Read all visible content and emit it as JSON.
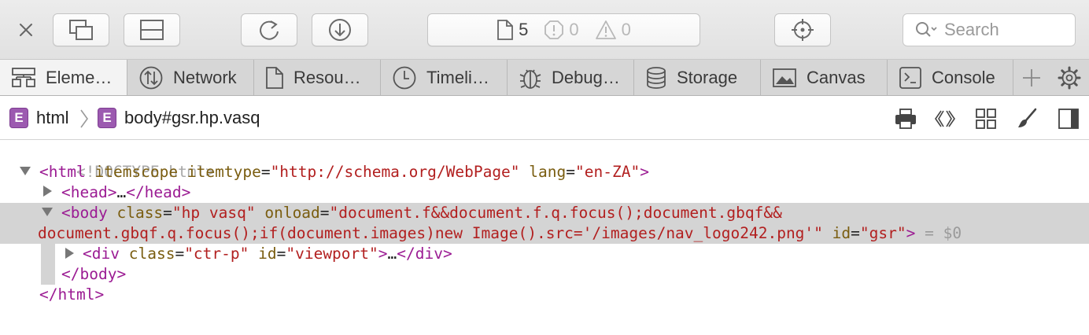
{
  "toolbar": {
    "counts": {
      "resources": "5",
      "errors": "0",
      "warnings": "0"
    },
    "search_placeholder": "Search"
  },
  "tabs": [
    {
      "label": "Eleme…",
      "icon": "elements-icon",
      "active": true
    },
    {
      "label": "Network",
      "icon": "network-icon"
    },
    {
      "label": "Resou…",
      "icon": "resources-icon"
    },
    {
      "label": "Timeli…",
      "icon": "timelines-icon"
    },
    {
      "label": "Debug…",
      "icon": "debugger-icon"
    },
    {
      "label": "Storage",
      "icon": "storage-icon"
    },
    {
      "label": "Canvas",
      "icon": "canvas-icon"
    },
    {
      "label": "Console",
      "icon": "console-icon"
    }
  ],
  "breadcrumb": [
    {
      "badge": "E",
      "label": "html"
    },
    {
      "badge": "E",
      "label": "body#gsr.hp.vasq"
    }
  ],
  "dom": {
    "doctype": "<!DOCTYPE html>",
    "html_open": {
      "tag": "html",
      "a1": "itemscope",
      "a2": "itemtype",
      "v2": "\"http://schema.org/WebPage\"",
      "a3": "lang",
      "v3": "\"en-ZA\""
    },
    "head": {
      "open": "<head>",
      "ellipsis": "…",
      "close": "</head>"
    },
    "body_open": {
      "tag": "body",
      "a1": "class",
      "v1": "\"hp vasq\"",
      "a2": "onload",
      "v2a": "\"document.f&&document.f.q.focus();document.gbqf&&",
      "v2b": "document.gbqf.q.focus();if(document.images)new Image().src='/images/nav_logo242.png'\"",
      "a3": "id",
      "v3": "\"gsr\"",
      "eq": "= $0"
    },
    "div": {
      "tag": "div",
      "a1": "class",
      "v1": "\"ctr-p\"",
      "a2": "id",
      "v2": "\"viewport\"",
      "ellipsis": "…",
      "close": "</div>"
    },
    "body_close": "</body>",
    "html_close": "</html>"
  }
}
